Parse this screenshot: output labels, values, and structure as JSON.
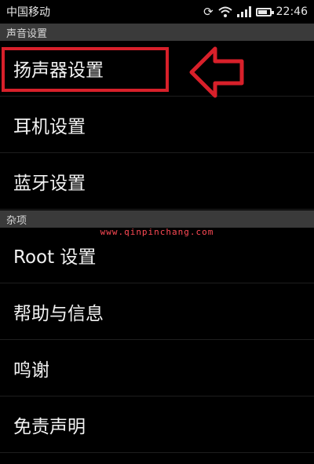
{
  "statusbar": {
    "carrier": "中国移动",
    "time": "22:46",
    "icons": [
      "sync-icon",
      "wifi-icon",
      "signal-icon",
      "battery-icon"
    ]
  },
  "sections": [
    {
      "header": "声音设置",
      "items": [
        "扬声器设置",
        "耳机设置",
        "蓝牙设置"
      ]
    },
    {
      "header": "杂项",
      "items": [
        "Root 设置",
        "帮助与信息",
        "鸣谢",
        "免责声明"
      ]
    }
  ],
  "annotation": {
    "highlight_color": "#d8202a",
    "arrow_icon": "left-arrow-icon"
  },
  "watermark": "www.qinpinchang.com"
}
